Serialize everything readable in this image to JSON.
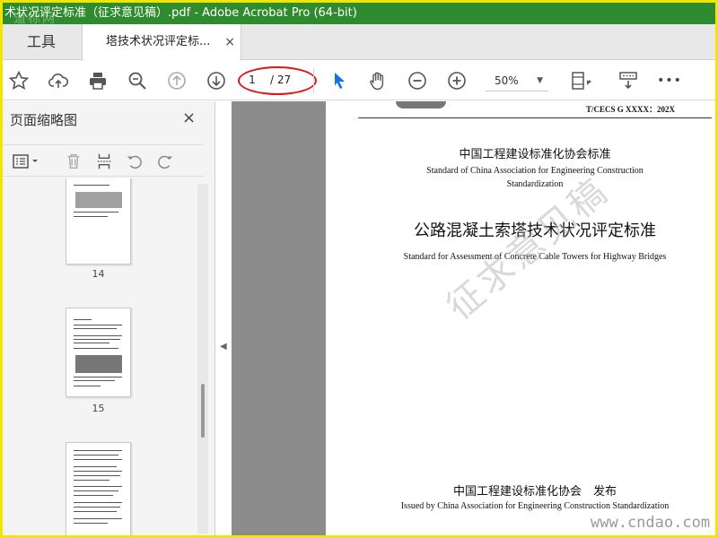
{
  "window": {
    "title": "术状况评定标准（征求意见稿）.pdf - Adobe Acrobat Pro (64-bit)",
    "logo_watermark": "道标网"
  },
  "tabs": {
    "tools_label": "工具",
    "document_label": "塔技术状况评定标...",
    "close_glyph": "×"
  },
  "toolbar": {
    "icons": [
      "star-icon",
      "cloud-upload-icon",
      "print-icon",
      "zoom-search-icon",
      "page-up-icon",
      "page-down-icon",
      "select-arrow-icon",
      "hand-icon",
      "zoom-out-icon",
      "zoom-in-icon",
      "fit-page-icon",
      "scroll-mode-icon",
      "more-icon"
    ],
    "page_current": "1",
    "page_total": "/ 27",
    "zoom_value": "50%",
    "more_glyph": "•••"
  },
  "sidebar": {
    "title": "页面缩略图",
    "close_glyph": "×",
    "thumbnails": [
      {
        "number": "14"
      },
      {
        "number": "15"
      },
      {
        "number": ""
      }
    ]
  },
  "document": {
    "code": "T/CECS G XXXX：202X",
    "org_cn": "中国工程建设标准化协会标准",
    "org_en": "Standard of China Association for Engineering Construction Standardization",
    "title_cn": "公路混凝土索塔技术状况评定标准",
    "title_en": "Standard for Assessment of Concrete Cable Towers for Highway Bridges",
    "stamp": "征求意见稿",
    "issuer_cn": "中国工程建设标准化协会　发布",
    "issuer_en": "Issued by China Association for Engineering Construction Standardization"
  },
  "site_watermark": "www.cndao.com",
  "colors": {
    "title_bar": "#2e8b2e",
    "frame_border": "#f2e600",
    "annotation_ellipse": "#e0141e",
    "select_tool_blue": "#1473e6"
  }
}
